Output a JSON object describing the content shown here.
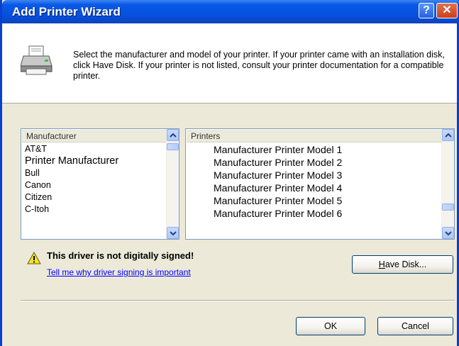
{
  "window": {
    "title": "Add Printer Wizard",
    "help_glyph": "?",
    "close_glyph": "✕"
  },
  "intro": {
    "text": "Select the manufacturer and model of your printer. If your printer came with an installation disk, click Have Disk. If your printer is not listed, consult your printer documentation for a compatible printer."
  },
  "manufacturer_list": {
    "header": "Manufacturer",
    "items": [
      "AT&T",
      "Printer Manufacturer",
      "Bull",
      "Canon",
      "Citizen",
      "C-Itoh"
    ]
  },
  "printer_list": {
    "header": "Printers",
    "items": [
      "Manufacturer Printer Model 1",
      "Manufacturer Printer Model 2",
      "Manufacturer Printer Model 3",
      "Manufacturer Printer Model 4",
      "Manufacturer Printer Model 5",
      "Manufacturer Printer Model 6"
    ]
  },
  "warning": {
    "text": "This driver is not digitally signed!",
    "link": "Tell me why driver signing is important"
  },
  "buttons": {
    "have_disk_prefix": "",
    "have_disk_ul": "H",
    "have_disk_rest": "ave Disk...",
    "ok": "OK",
    "cancel": "Cancel"
  },
  "colors": {
    "titlebar": "#0a58e8",
    "dialog_bg": "#ece9d8",
    "link": "#0000ff"
  },
  "icons": [
    "printer-icon",
    "warning-icon",
    "help-icon",
    "close-icon",
    "chevron-up-icon",
    "chevron-down-icon"
  ]
}
